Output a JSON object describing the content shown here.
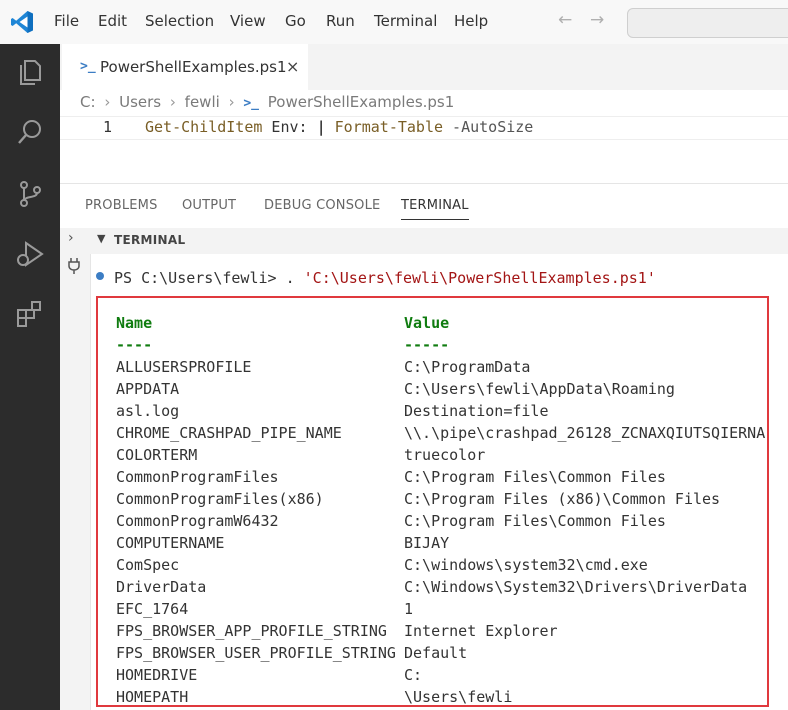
{
  "menu": [
    "File",
    "Edit",
    "Selection",
    "View",
    "Go",
    "Run",
    "Terminal",
    "Help"
  ],
  "nav": {
    "back": "←",
    "forward": "→"
  },
  "activity_bar": [
    "explorer-icon",
    "search-icon",
    "source-control-icon",
    "run-debug-icon",
    "extensions-icon"
  ],
  "editor": {
    "tab_label": "PowerShellExamples.ps1",
    "tab_close": "×",
    "breadcrumb": [
      "C:",
      "Users",
      "fewli",
      "PowerShellExamples.ps1"
    ],
    "line_number": "1",
    "code": {
      "cmd1": "Get-ChildItem",
      "arg1": " Env: ",
      "pipe": "|",
      "space": " ",
      "cmd2": "Format-Table",
      "param": " -AutoSize"
    }
  },
  "panel": {
    "tabs": [
      "PROBLEMS",
      "OUTPUT",
      "DEBUG CONSOLE",
      "TERMINAL"
    ],
    "active_tab": "TERMINAL",
    "terminal_header": "TERMINAL",
    "prompt_text": "PS C:\\Users\\fewli> . ",
    "prompt_path": "'C:\\Users\\fewli\\PowerShellExamples.ps1'"
  },
  "table": {
    "headers": [
      "Name",
      "Value"
    ],
    "underlines": [
      "----",
      "-----"
    ],
    "rows": [
      [
        "ALLUSERSPROFILE",
        "C:\\ProgramData"
      ],
      [
        "APPDATA",
        "C:\\Users\\fewli\\AppData\\Roaming"
      ],
      [
        "asl.log",
        "Destination=file"
      ],
      [
        "CHROME_CRASHPAD_PIPE_NAME",
        "\\\\.\\pipe\\crashpad_26128_ZCNAXQIUTSQIERNA"
      ],
      [
        "COLORTERM",
        "truecolor"
      ],
      [
        "CommonProgramFiles",
        "C:\\Program Files\\Common Files"
      ],
      [
        "CommonProgramFiles(x86)",
        "C:\\Program Files (x86)\\Common Files"
      ],
      [
        "CommonProgramW6432",
        "C:\\Program Files\\Common Files"
      ],
      [
        "COMPUTERNAME",
        "BIJAY"
      ],
      [
        "ComSpec",
        "C:\\windows\\system32\\cmd.exe"
      ],
      [
        "DriverData",
        "C:\\Windows\\System32\\Drivers\\DriverData"
      ],
      [
        "EFC_1764",
        "1"
      ],
      [
        "FPS_BROWSER_APP_PROFILE_STRING",
        "Internet Explorer"
      ],
      [
        "FPS_BROWSER_USER_PROFILE_STRING",
        "Default"
      ],
      [
        "HOMEDRIVE",
        "C:"
      ],
      [
        "HOMEPATH",
        "\\Users\\fewli"
      ]
    ]
  },
  "colors": {
    "accent": "#3c7dc4",
    "highlight_border": "#e0393e",
    "header_green": "#107c10",
    "activity_bar": "#2c2c2c"
  }
}
